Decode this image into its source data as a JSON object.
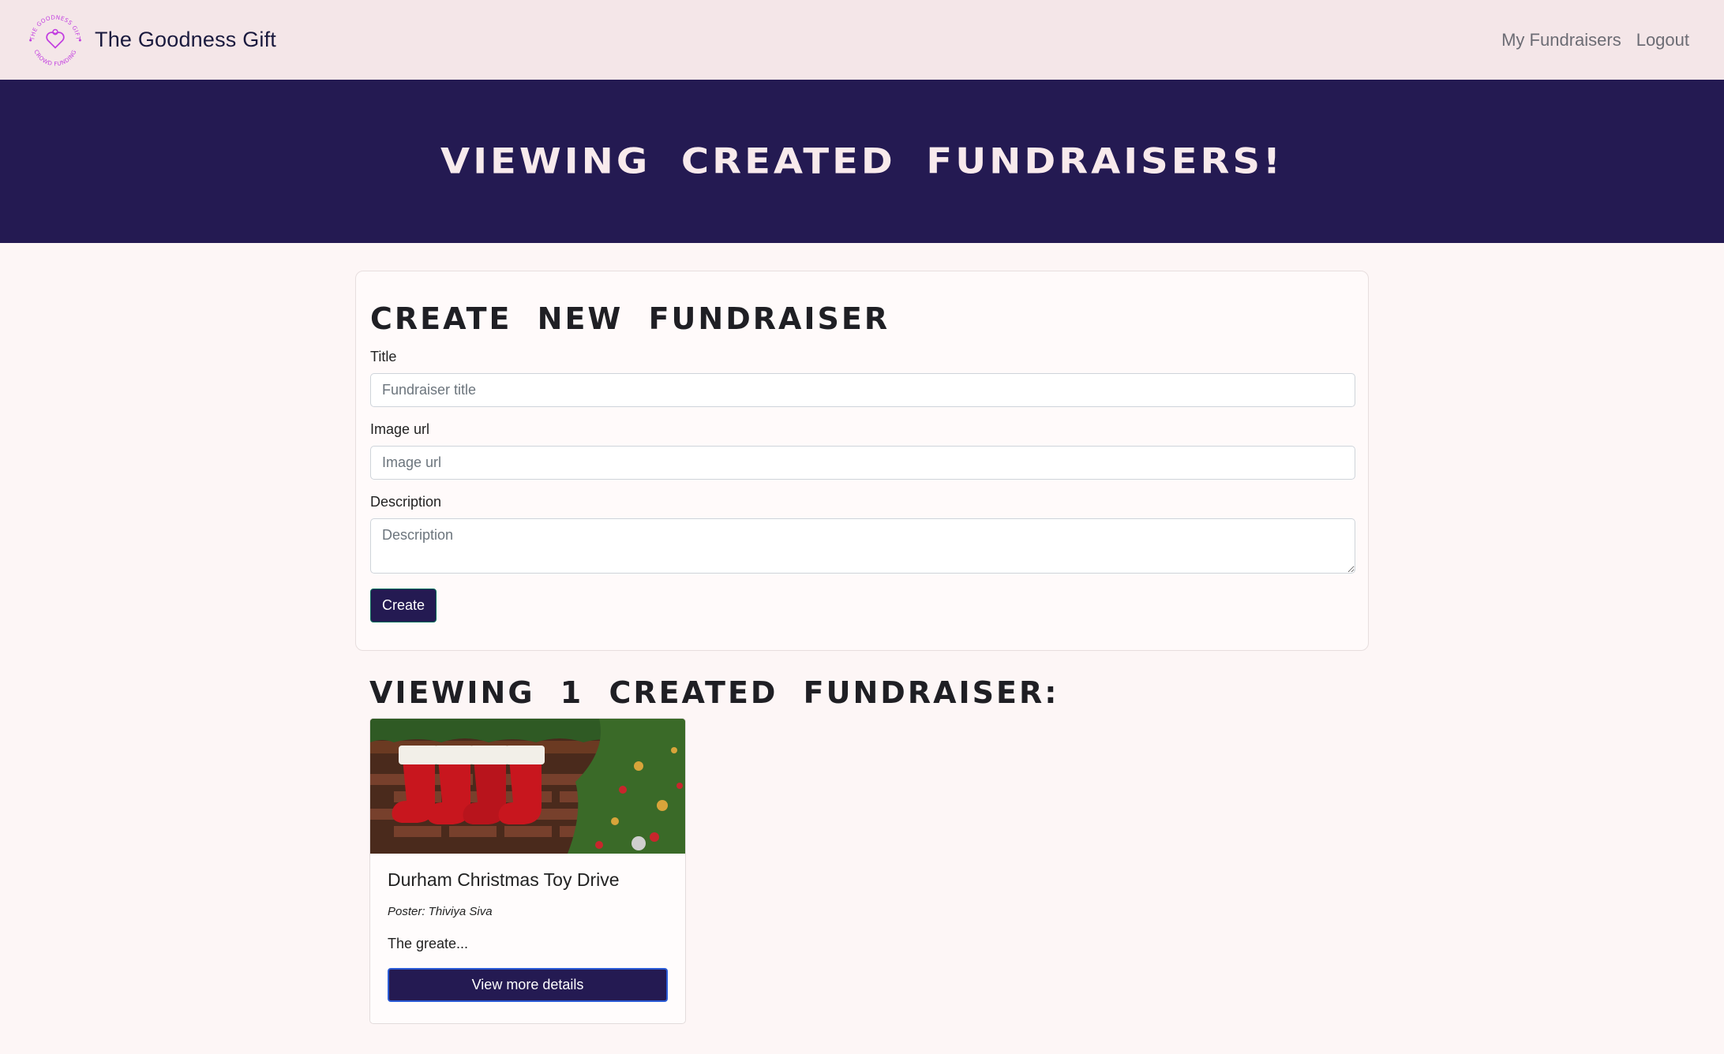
{
  "navbar": {
    "brand_name": "The Goodness Gift",
    "logo_text_top": "THE GOODNESS GIFT",
    "logo_text_bottom": "CROWD FUNDING",
    "links": [
      "My Fundraisers",
      "Logout"
    ]
  },
  "hero": {
    "title": "Viewing created fundraisers!"
  },
  "form": {
    "heading": "Create new fundraiser",
    "title_label": "Title",
    "title_placeholder": "Fundraiser title",
    "image_label": "Image url",
    "image_placeholder": "Image url",
    "description_label": "Description",
    "description_placeholder": "Description",
    "submit_label": "Create"
  },
  "list": {
    "heading": "Viewing 1 created fundraiser:",
    "cards": [
      {
        "title": "Durham Christmas Toy Drive",
        "poster": "Poster: Thiviya Siva",
        "excerpt": "The greate...",
        "button_label": "View more details"
      }
    ]
  },
  "colors": {
    "navbar_bg": "#f4e6e8",
    "hero_bg": "#241a52",
    "accent": "#241a52",
    "logo": "#c23ee0"
  }
}
